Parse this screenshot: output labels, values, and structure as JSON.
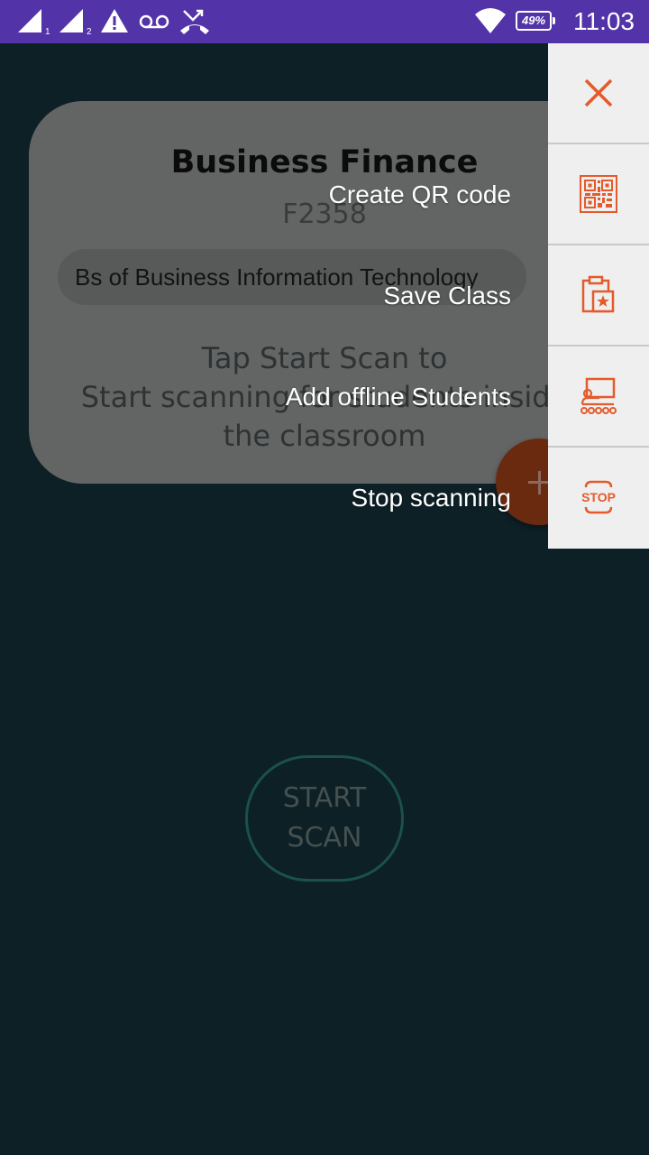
{
  "status_bar": {
    "time": "11:03",
    "battery": "49%",
    "background": "#5233a8",
    "icons": [
      "signal-sim1-icon",
      "signal-sim2-icon",
      "warning-icon",
      "voicemail-icon",
      "missed-call-icon",
      "wifi-icon",
      "battery-icon"
    ]
  },
  "class_card": {
    "title": "Business Finance",
    "code": "F2358",
    "program": "Bs of Business Information Technology",
    "instruction_line1": "Tap Start Scan to",
    "instruction_line2": "Start scanning for students inside",
    "instruction_line3": "the classroom"
  },
  "start_scan": {
    "line1": "START",
    "line2": "SCAN"
  },
  "menu": {
    "accent": "#e55a2b",
    "items": [
      {
        "label": "Create QR code",
        "icon": "qr-code-icon"
      },
      {
        "label": "Save Class",
        "icon": "clipboard-star-icon"
      },
      {
        "label": "Add offline Students",
        "icon": "classroom-icon"
      },
      {
        "label": "Stop scanning",
        "icon": "stop-icon"
      }
    ],
    "close_icon": "close-icon"
  }
}
